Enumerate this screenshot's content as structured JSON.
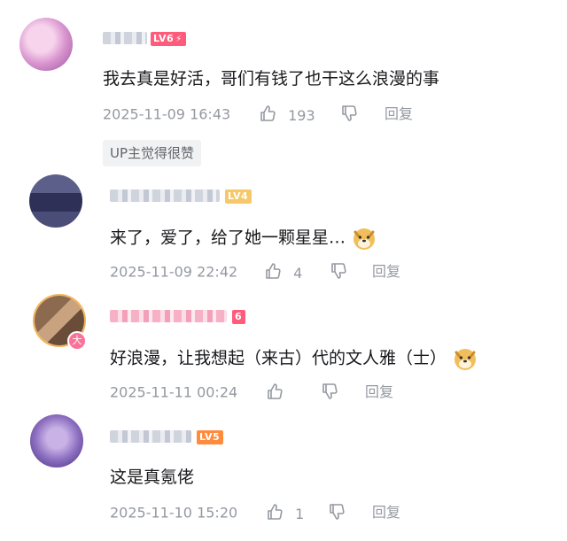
{
  "comments": [
    {
      "level": "LV6",
      "text": "我去真是好活，哥们有钱了也干这么浪漫的事",
      "time": "2025-11-09 16:43",
      "likes": "193",
      "reply_label": "回复",
      "badge": "UP主觉得很赞"
    },
    {
      "level": "LV4",
      "text": "来了，爱了，给了她一颗星星…",
      "time": "2025-11-09 22:42",
      "likes": "4",
      "reply_label": "回复",
      "emote": "doge-emote"
    },
    {
      "level": "6",
      "avatar_badge": "大",
      "text": "好浪漫，让我想起（来古）代的文人雅（士）",
      "time": "2025-11-11 00:24",
      "likes": "",
      "reply_label": "回复",
      "emote": "doge-emote"
    },
    {
      "level": "LV5",
      "text": "这是真氪佬",
      "time": "2025-11-10 15:20",
      "likes": "1",
      "reply_label": "回复"
    }
  ],
  "colors": {
    "text": "#18191c",
    "meta": "#9499a0",
    "lv6": "#ff5c7c",
    "lv4": "#f6c86a",
    "lv5": "#ff8c3d"
  }
}
